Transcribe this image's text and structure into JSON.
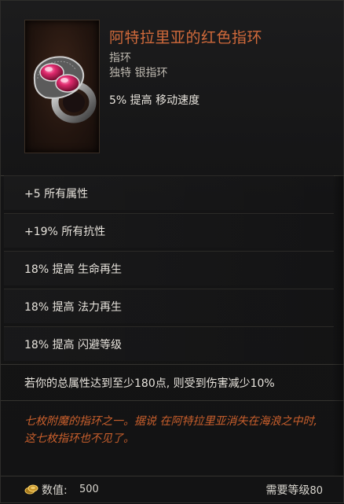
{
  "item": {
    "name": "阿特拉里亚的红色指环",
    "type": "指环",
    "rarity_base": "独特 银指环",
    "implicit": "5% 提高 移动速度",
    "icon": "ruby-ring-icon"
  },
  "affixes": [
    "+5 所有属性",
    "+19% 所有抗性",
    "18% 提高 生命再生",
    "18% 提高 法力再生",
    "18% 提高 闪避等级"
  ],
  "unique_effect": "若你的总属性达到至少180点, 则受到伤害减少10%",
  "lore": "七枚附魔的指环之一。据说 在阿特拉里亚消失在海浪之中时, 这七枚指环也不见了。",
  "footer": {
    "value_label": "数值:",
    "value": "500",
    "requirement_label": "需要等级",
    "requirement_level": "80",
    "coin_icon": "gold-coin-icon"
  },
  "colors": {
    "name": "#d16a3b",
    "lore": "#c95f2c",
    "text": "#e7e3dc",
    "background": "#141415"
  }
}
